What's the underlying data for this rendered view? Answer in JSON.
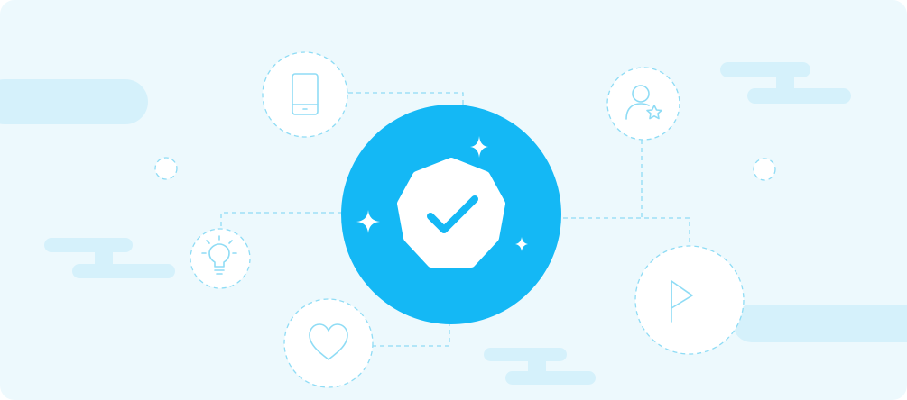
{
  "palette": {
    "background": "#edf9fd",
    "cloud": "#d5f1fb",
    "connector": "#8fdcf5",
    "icon_stroke": "#8fdcf5",
    "accent": "#14b8f5",
    "badge_fill": "#ffffff",
    "check": "#14b8f5",
    "sparkle": "#ffffff"
  },
  "hero": {
    "badge_icon": "verified-checkmark-icon",
    "sparkle_icon": "sparkle-icon"
  },
  "satellites": [
    {
      "name": "tablet-icon"
    },
    {
      "name": "user-star-icon"
    },
    {
      "name": "lightbulb-icon"
    },
    {
      "name": "heart-icon"
    },
    {
      "name": "flag-icon"
    }
  ],
  "decorations": {
    "dots": [
      "small-dot-left",
      "small-dot-right"
    ],
    "clouds": 5
  }
}
